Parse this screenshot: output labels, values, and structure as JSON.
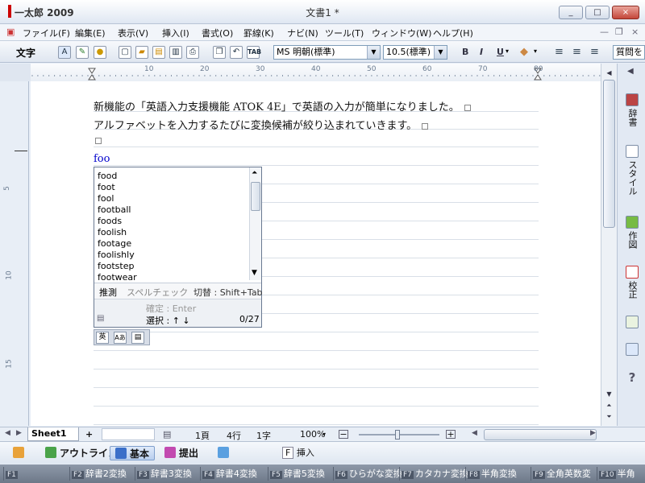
{
  "app": {
    "title": "一太郎 2009",
    "document_title": "文書1 *",
    "window_buttons": {
      "minimize": "_",
      "maximize": "□",
      "close": "×"
    }
  },
  "menu": [
    "ファイル(F)",
    "編集(E)",
    "表示(V)",
    "挿入(I)",
    "書式(O)",
    "罫線(K)",
    "ナビ(N)",
    "ツール(T)",
    "ウィンドウ(W)",
    "ヘルプ(H)"
  ],
  "menu_right": {
    "minimize": "—",
    "restore": "❐",
    "close": "×"
  },
  "toolbar": {
    "style_label": "文字",
    "font_name": "MS 明朝(標準)",
    "font_size": "10.5(標準)",
    "tab_label": "TAB",
    "bold": "B",
    "italic": "I",
    "underline": "U",
    "search_cut": "質問を"
  },
  "ruler": {
    "numbers": [
      "10",
      "20",
      "30",
      "40",
      "50",
      "60",
      "70",
      "80"
    ]
  },
  "vruler": {
    "numbers": [
      "5",
      "10",
      "15"
    ]
  },
  "document": {
    "line1": "新機能の「英語入力支援機能 ATOK 4E」で英語の入力が簡単になりました。",
    "line2": "アルファベットを入力するたびに変換候補が絞り込まれていきます。",
    "input": "foo"
  },
  "ime": {
    "candidates": [
      "food",
      "foot",
      "fool",
      "football",
      "foods",
      "foolish",
      "footage",
      "foolishly",
      "footstep",
      "footwear"
    ],
    "tab_predict": "推測",
    "tab_spell": "スペルチェック",
    "switch": "切替 : Shift+Tab",
    "confirm": "確定 : Enter",
    "select": "選択 : ↑ ↓",
    "count": "0/27"
  },
  "ime_mini": [
    "英",
    "Aあ",
    "▤"
  ],
  "side_panel": [
    "辞書",
    "スタイル",
    "作図",
    "校正"
  ],
  "side_help": "?",
  "sheet": {
    "tab": "Sheet1",
    "add": "+"
  },
  "status": {
    "page": "1頁",
    "line": "4行",
    "char": "1字",
    "zoom": "100%"
  },
  "modes": [
    {
      "label": "",
      "color": "#e8a23a"
    },
    {
      "label": "アウトライン",
      "color": "#4aa34a"
    },
    {
      "label": "基本",
      "color": "#3a6fc9"
    },
    {
      "label": "提出",
      "color": "#c24ab0"
    },
    {
      "label": "",
      "color": "#5aa0e0"
    }
  ],
  "insert_mode": {
    "key": "F",
    "label": "挿入"
  },
  "fkeys": [
    {
      "key": "F1",
      "label": ""
    },
    {
      "key": "F2",
      "label": "辞書2変換"
    },
    {
      "key": "F3",
      "label": "辞書3変換"
    },
    {
      "key": "F4",
      "label": "辞書4変換"
    },
    {
      "key": "F5",
      "label": "辞書5変換"
    },
    {
      "key": "F6",
      "label": "ひらがな変換"
    },
    {
      "key": "F7",
      "label": "カタカナ変換"
    },
    {
      "key": "F8",
      "label": "半角変換"
    },
    {
      "key": "F9",
      "label": "全角英数変"
    },
    {
      "key": "F10",
      "label": "半角"
    }
  ]
}
